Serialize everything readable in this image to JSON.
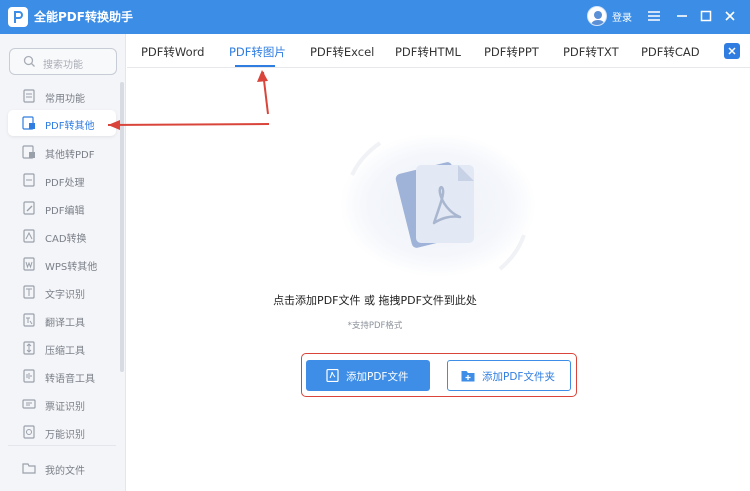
{
  "app": {
    "title": "全能PDF转换助手",
    "login_label": "登录",
    "accent_color": "#3b8de6",
    "icons": [
      "app-logo-icon",
      "user-avatar-icon",
      "menu-icon",
      "minimize-icon",
      "maximize-icon",
      "close-icon"
    ]
  },
  "sidebar": {
    "search_placeholder": "搜索功能",
    "items": [
      {
        "label": "常用功能",
        "icon": "common-icon"
      },
      {
        "label": "PDF转其他",
        "icon": "pdf-convert-icon",
        "active": true
      },
      {
        "label": "其他转PDF",
        "icon": "to-pdf-icon"
      },
      {
        "label": "PDF处理",
        "icon": "pdf-process-icon"
      },
      {
        "label": "PDF编辑",
        "icon": "pdf-edit-icon"
      },
      {
        "label": "CAD转换",
        "icon": "cad-icon"
      },
      {
        "label": "WPS转其他",
        "icon": "wps-icon"
      },
      {
        "label": "文字识别",
        "icon": "ocr-icon"
      },
      {
        "label": "翻译工具",
        "icon": "translate-icon"
      },
      {
        "label": "压缩工具",
        "icon": "compress-icon"
      },
      {
        "label": "转语音工具",
        "icon": "speech-icon"
      },
      {
        "label": "票证识别",
        "icon": "ticket-icon"
      },
      {
        "label": "万能识别",
        "icon": "universal-icon"
      }
    ],
    "footer_item": {
      "label": "我的文件",
      "icon": "my-files-icon"
    }
  },
  "tabs": [
    {
      "label": "PDF转Word"
    },
    {
      "label": "PDF转图片",
      "active": true
    },
    {
      "label": "PDF转Excel"
    },
    {
      "label": "PDF转HTML"
    },
    {
      "label": "PDF转PPT"
    },
    {
      "label": "PDF转TXT"
    },
    {
      "label": "PDF转CAD"
    }
  ],
  "main": {
    "drop_text": "点击添加PDF文件 或 拖拽PDF文件到此处",
    "support_text": "*支持PDF格式",
    "add_file_label": "添加PDF文件",
    "add_folder_label": "添加PDF文件夹",
    "highlight_color": "#d9453a"
  }
}
